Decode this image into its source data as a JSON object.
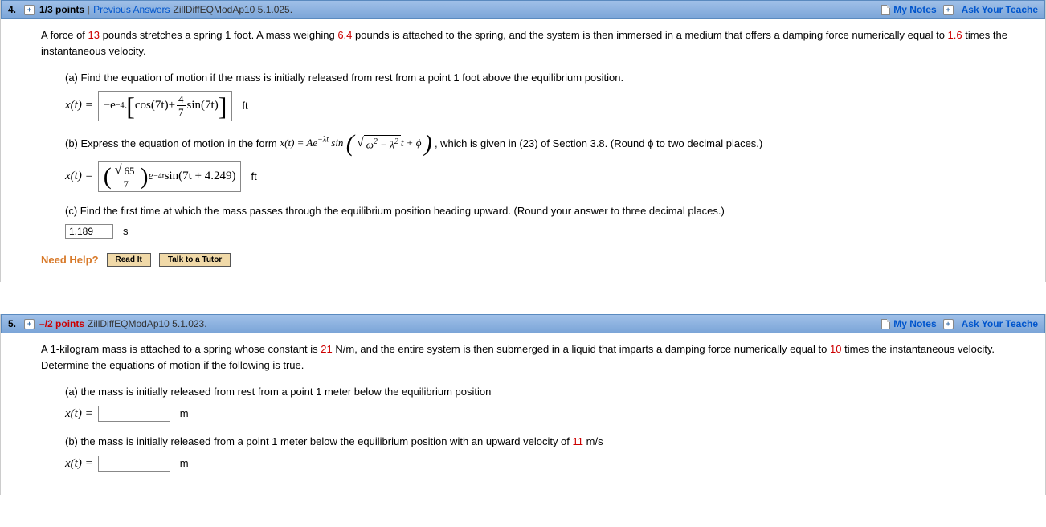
{
  "questions": [
    {
      "number": "4.",
      "points": "1/3 points",
      "prev_answers_label": "Previous Answers",
      "source": "ZillDiffEQModAp10 5.1.025.",
      "my_notes": "My Notes",
      "ask": "Ask Your Teache",
      "prompt_before_13": "A force of ",
      "val_13": "13",
      "prompt_mid1": " pounds stretches a spring 1 foot. A mass weighing ",
      "val_64": "6.4",
      "prompt_mid2": " pounds is attached to the spring, and the system is then immersed in a medium that offers a damping force numerically equal to ",
      "val_16": "1.6",
      "prompt_after": " times the instantaneous velocity.",
      "part_a": "(a) Find the equation of motion if the mass is initially released from rest from a point 1 foot above the equilibrium position.",
      "xt_label": "x(t) = ",
      "ans_a_unit": "ft",
      "part_b_pre": "(b) Express the equation of motion in the form ",
      "part_b_post": ",  which is given in (23) of Section 3.8. (Round ϕ to two decimal places.)",
      "ans_b_unit": "ft",
      "part_c": "(c) Find the first time at which the mass passes through the equilibrium position heading upward. (Round your answer to three decimal places.)",
      "ans_c_value": "1.189",
      "ans_c_unit": "s",
      "need_help": "Need Help?",
      "read_it": "Read It",
      "talk_tutor": "Talk to a Tutor",
      "formula_a": {
        "neg_e": "−e",
        "exp": "−4t",
        "cos": "cos",
        "seven_t": "7t",
        "plus": " + ",
        "frac_num": "4",
        "frac_den": "7",
        "sin": "sin"
      },
      "formula_b_inline": {
        "xt_eq": "x(t) = Ae",
        "exp": "−λt",
        "sin": " sin",
        "omega": "ω",
        "sq": "2",
        "minus": " − λ",
        "t_plus_phi": "t + ϕ"
      },
      "formula_b_ans": {
        "sqrt_val": "65",
        "den": "7",
        "e": "e",
        "exp": "−4t",
        "sin": "sin",
        "inner": "7t + 4.249"
      }
    },
    {
      "number": "5.",
      "points": "–/2 points",
      "source": "ZillDiffEQModAp10 5.1.023.",
      "my_notes": "My Notes",
      "ask": "Ask Your Teache",
      "prompt_pre": "A 1-kilogram mass is attached to a spring whose constant is ",
      "val_21": "21",
      "prompt_mid": " N/m, and the entire system is then submerged in a liquid that imparts a damping force numerically equal to ",
      "val_10": "10",
      "prompt_post": " times the instantaneous velocity. Determine the equations of motion if the following is true.",
      "part_a": "(a) the mass is initially released from rest from a point 1 meter below the equilibrium position",
      "xt_label": "x(t) = ",
      "unit_m": "m",
      "part_b_pre": "(b) the mass is initially released from a point 1 meter below the equilibrium position with an upward velocity of ",
      "val_11": "11",
      "part_b_post": " m/s"
    }
  ]
}
